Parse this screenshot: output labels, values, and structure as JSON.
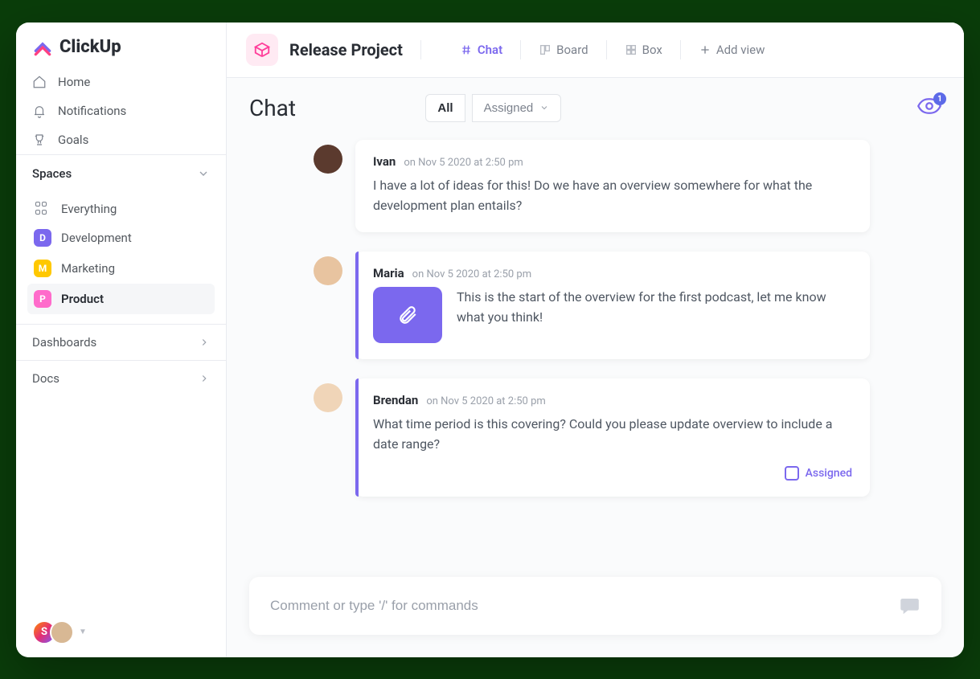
{
  "brand": "ClickUp",
  "nav": {
    "home": "Home",
    "notifications": "Notifications",
    "goals": "Goals"
  },
  "sidebar": {
    "spaces_header": "Spaces",
    "everything": "Everything",
    "spaces": [
      {
        "initial": "D",
        "label": "Development",
        "color": "#7b68ee"
      },
      {
        "initial": "M",
        "label": "Marketing",
        "color": "#ffc800"
      },
      {
        "initial": "P",
        "label": "Product",
        "color": "#ff6bcb"
      }
    ],
    "dashboards": "Dashboards",
    "docs": "Docs",
    "user_initial": "S"
  },
  "topbar": {
    "project_title": "Release Project",
    "tabs": {
      "chat": "Chat",
      "board": "Board",
      "box": "Box",
      "add": "Add view"
    }
  },
  "chat": {
    "title": "Chat",
    "filter_all": "All",
    "filter_assigned": "Assigned",
    "watch_count": "1"
  },
  "messages": [
    {
      "author": "Ivan",
      "time": "on Nov 5 2020 at 2:50 pm",
      "body": "I have a lot of ideas for this! Do we have an overview somewhere for what the development plan entails?",
      "attachment": false,
      "accent": false,
      "assigned": false
    },
    {
      "author": "Maria",
      "time": "on Nov 5 2020 at 2:50 pm",
      "body": "This is the start of the overview for the first podcast, let me know what you think!",
      "attachment": true,
      "accent": true,
      "assigned": false
    },
    {
      "author": "Brendan",
      "time": "on Nov 5 2020 at 2:50 pm",
      "body": "What time period is this covering? Could you please update overview to include a date range?",
      "attachment": false,
      "accent": true,
      "assigned": true
    }
  ],
  "assigned_label": "Assigned",
  "composer_placeholder": "Comment or type '/' for commands"
}
